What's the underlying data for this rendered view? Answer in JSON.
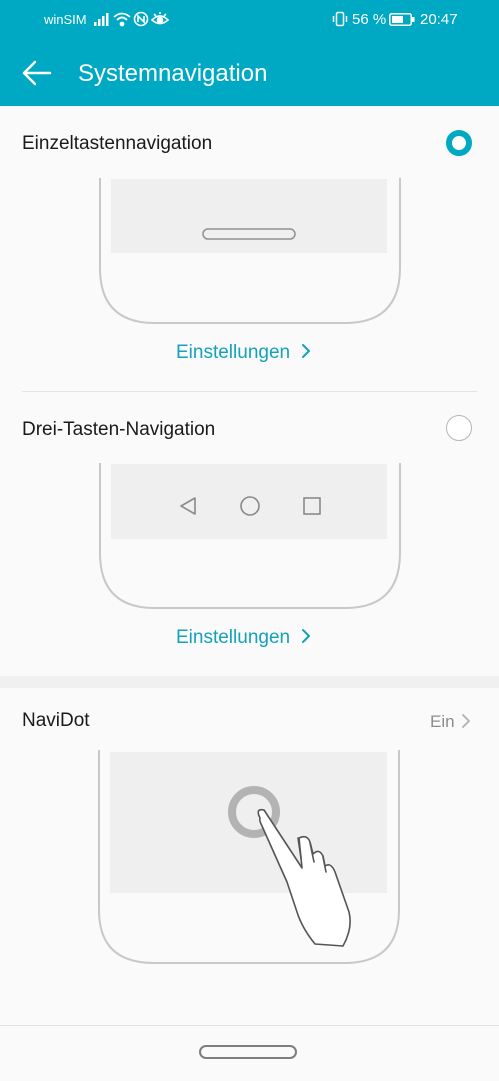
{
  "status_bar": {
    "carrier": "winSIM",
    "battery_percent": "56 %",
    "time": "20:47",
    "icons": [
      "signal-icon",
      "wifi-icon",
      "nfc-icon",
      "eye-comfort-icon",
      "vibrate-icon",
      "battery-icon"
    ]
  },
  "app_bar": {
    "title": "Systemnavigation",
    "back_icon": "back-arrow-icon"
  },
  "options": [
    {
      "label": "Einzeltastennavigation",
      "selected": true,
      "settings_link": "Einstellungen"
    },
    {
      "label": "Drei-Tasten-Navigation",
      "selected": false,
      "settings_link": "Einstellungen"
    }
  ],
  "navidot": {
    "label": "NaviDot",
    "value": "Ein"
  },
  "colors": {
    "accent": "#00a9c3",
    "link": "#13a2ba",
    "background": "#fafafa"
  }
}
